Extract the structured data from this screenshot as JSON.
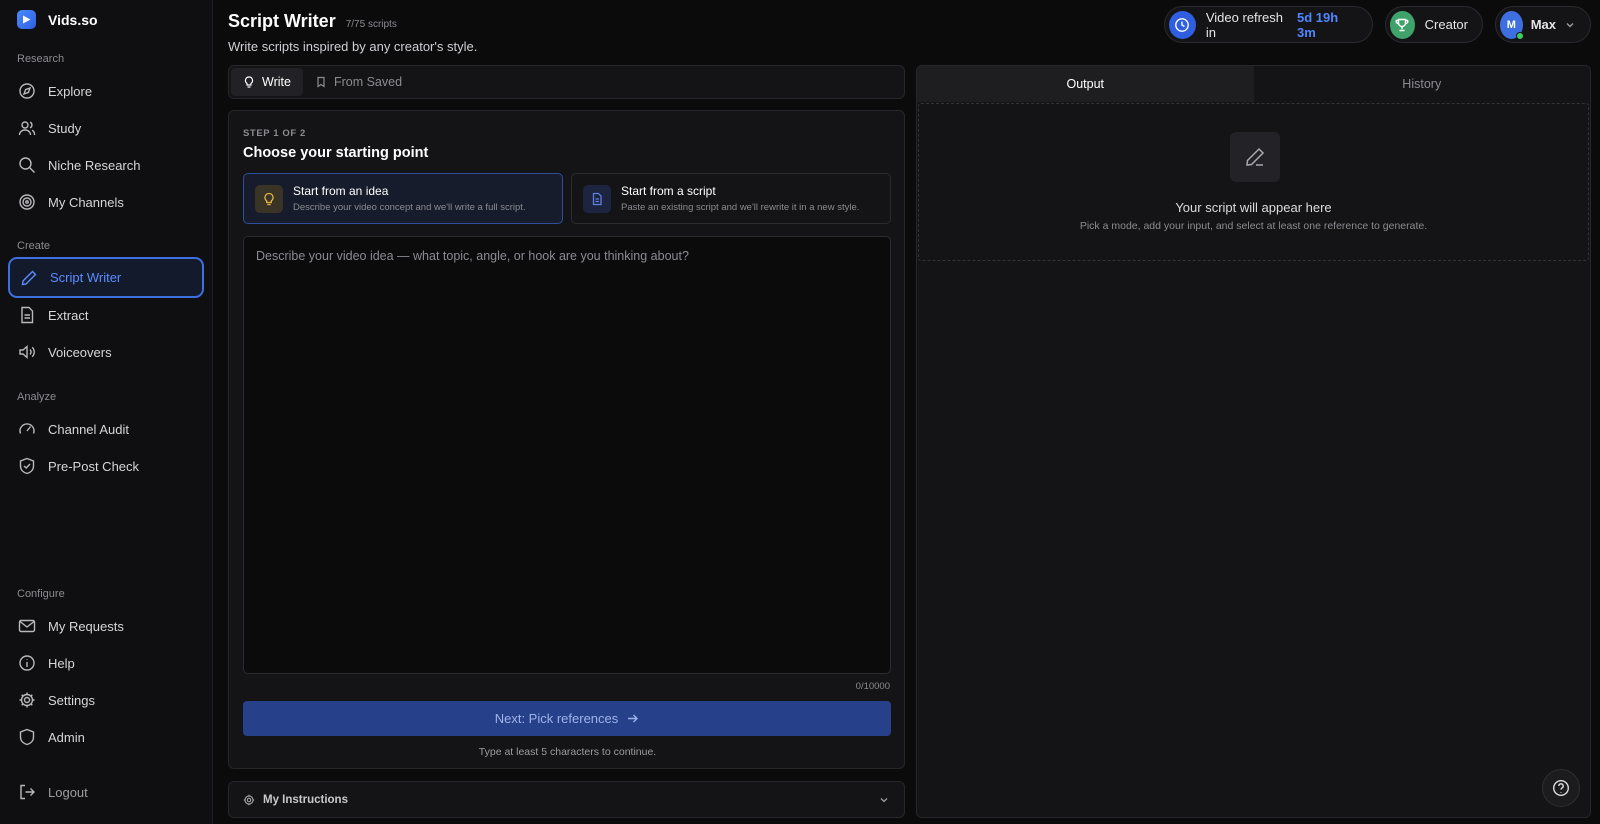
{
  "brand": {
    "name": "Vids.so"
  },
  "sidebar": {
    "sections": [
      {
        "label": "Research"
      },
      {
        "label": "Create"
      },
      {
        "label": "Analyze"
      },
      {
        "label": "Configure"
      }
    ],
    "items": [
      {
        "label": "Explore",
        "icon": "compass-icon"
      },
      {
        "label": "Study",
        "icon": "users-icon"
      },
      {
        "label": "Niche Research",
        "icon": "search-icon"
      },
      {
        "label": "My Channels",
        "icon": "target-icon"
      },
      {
        "label": "Script Writer",
        "icon": "pen-icon",
        "active": true
      },
      {
        "label": "Extract",
        "icon": "document-icon"
      },
      {
        "label": "Voiceovers",
        "icon": "speaker-icon"
      },
      {
        "label": "Channel Audit",
        "icon": "gauge-icon"
      },
      {
        "label": "Pre-Post Check",
        "icon": "shield-check-icon"
      },
      {
        "label": "My Requests",
        "icon": "mail-icon"
      },
      {
        "label": "Help",
        "icon": "info-icon"
      },
      {
        "label": "Settings",
        "icon": "gear-icon"
      },
      {
        "label": "Admin",
        "icon": "shield-icon"
      }
    ],
    "logout": "Logout"
  },
  "header": {
    "title": "Script Writer",
    "count": "7/75 scripts",
    "subtitle": "Write scripts inspired by any creator's style.",
    "refresh_label": "Video refresh in",
    "refresh_time": "5d 19h 3m",
    "plan": "Creator",
    "user_initial": "M",
    "user_name": "Max"
  },
  "mode_tabs": [
    {
      "label": "Write",
      "active": true
    },
    {
      "label": "From Saved",
      "active": false
    }
  ],
  "card": {
    "step": "STEP 1 OF 2",
    "heading": "Choose your starting point",
    "options": [
      {
        "title": "Start from an idea",
        "desc": "Describe your video concept and we'll write a full script.",
        "selected": true
      },
      {
        "title": "Start from a script",
        "desc": "Paste an existing script and we'll rewrite it in a new style.",
        "selected": false
      }
    ],
    "placeholder": "Describe your video idea — what topic, angle, or hook are you thinking about?",
    "value": "",
    "char_count": "0/10000",
    "next_label": "Next: Pick references",
    "hint": "Type at least 5 characters to continue."
  },
  "instructions": {
    "label": "My Instructions"
  },
  "output": {
    "tabs": [
      {
        "label": "Output",
        "active": true
      },
      {
        "label": "History",
        "active": false
      }
    ],
    "empty_title": "Your script will appear here",
    "empty_desc": "Pick a mode, add your input, and select at least one reference to generate."
  },
  "colors": {
    "accent": "#4f86ff",
    "background": "#0b0b0c",
    "panel": "#141416",
    "plan_badge": "#3fa26a",
    "online": "#3ecf5f"
  }
}
